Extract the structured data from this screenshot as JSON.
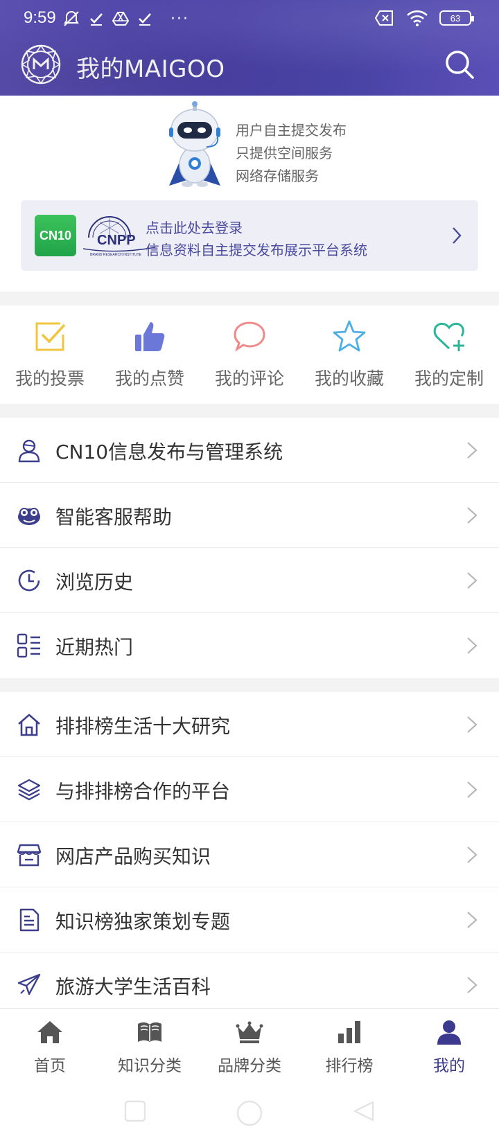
{
  "status_bar": {
    "time": "9:59",
    "battery": "63",
    "icons_left": [
      "mute-icon",
      "check-icon",
      "drive-icon",
      "check-icon"
    ],
    "icons_right": [
      "sim-off-icon",
      "wifi-icon",
      "battery-icon"
    ],
    "more": "···"
  },
  "header": {
    "title": "我的MAIGOO",
    "logo_icon": "maigoo-logo",
    "search_icon": "search-icon"
  },
  "profile": {
    "intro_lines": [
      "用户自主提交发布",
      "只提供空间服务",
      "网络存储服务"
    ],
    "login": {
      "line1": "点击此处去登录",
      "line2": "信息资料自主提交发布展示平台系统",
      "cn10_logo_text": "CN10",
      "cnpp_logo_text": "CNPP",
      "cnpp_sub_text": "BRAND RESEARCH INSTITUTE"
    }
  },
  "actions": [
    {
      "label": "我的投票",
      "icon": "vote-icon",
      "color": "#f0c640"
    },
    {
      "label": "我的点赞",
      "icon": "thumbs-up-icon",
      "color": "#6b78d8"
    },
    {
      "label": "我的评论",
      "icon": "comment-icon",
      "color": "#f08a8a"
    },
    {
      "label": "我的收藏",
      "icon": "star-icon",
      "color": "#4aaee8"
    },
    {
      "label": "我的定制",
      "icon": "heart-plus-icon",
      "color": "#2bb598"
    }
  ],
  "menu_group_1": [
    {
      "label": "CN10信息发布与管理系统",
      "icon": "user-icon"
    },
    {
      "label": "智能客服帮助",
      "icon": "robot-face-icon"
    },
    {
      "label": "浏览历史",
      "icon": "history-icon"
    },
    {
      "label": "近期热门",
      "icon": "list-grid-icon"
    }
  ],
  "menu_group_2": [
    {
      "label": "排排榜生活十大研究",
      "icon": "home-icon"
    },
    {
      "label": "与排排榜合作的平台",
      "icon": "layers-icon"
    },
    {
      "label": "网店产品购买知识",
      "icon": "store-icon"
    },
    {
      "label": "知识榜独家策划专题",
      "icon": "document-icon"
    },
    {
      "label": "旅游大学生活百科",
      "icon": "plane-icon"
    }
  ],
  "bottom_nav": [
    {
      "label": "首页",
      "icon": "home-filled-icon",
      "active": false
    },
    {
      "label": "知识分类",
      "icon": "book-icon",
      "active": false
    },
    {
      "label": "品牌分类",
      "icon": "crown-icon",
      "active": false
    },
    {
      "label": "排行榜",
      "icon": "bar-chart-icon",
      "active": false
    },
    {
      "label": "我的",
      "icon": "person-icon",
      "active": true
    }
  ],
  "colors": {
    "header_bg": "#4b42a6",
    "accent": "#3b3a8f",
    "icon_blue": "#3d3f8c"
  }
}
